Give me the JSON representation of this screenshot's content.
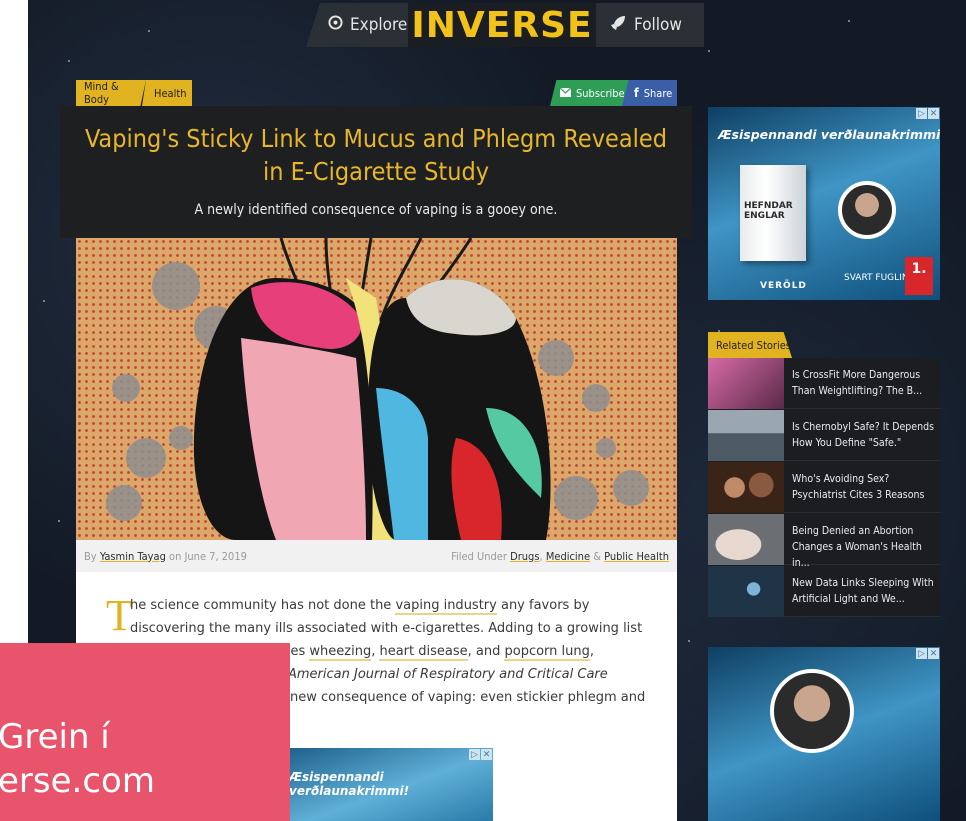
{
  "nav": {
    "explore_label": "Explore",
    "logo_text": "INVERSE",
    "follow_label": "Follow"
  },
  "article": {
    "categories": [
      "Mind & Body",
      "Health"
    ],
    "subscribe_label": "Subscribe",
    "share_label": "Share",
    "headline": "Vaping's Sticky Link to Mucus and Phlegm Revealed in E-Cigarette Study",
    "subheadline": "A newly identified consequence of vaping is a gooey one.",
    "byline": {
      "by": "By",
      "author": "Yasmin Tayag",
      "on": "on June 7, 2019",
      "filed_under": "Filed Under",
      "tags": [
        "Drugs",
        "Medicine",
        "Public Health"
      ],
      "sep1": ",",
      "sep2": "&"
    },
    "dropcap": "T",
    "body": {
      "l1_a": "he science community has not done the ",
      "l1_link": "vaping industry",
      "l1_b": " any favors by",
      "l2": "discovering the many ills associated with e-cigarettes. Adding to a growing list",
      "l3_a": "udes ",
      "l3_link1": "wheezing",
      "l3_sep1": ", ",
      "l3_link2": "heart disease",
      "l3_sep2": ", and ",
      "l3_link3": "popcorn lung",
      "l3_end": ",",
      "l4": "American Journal of Respiratory and Critical Care",
      "l5": "new consequence of vaping: even stickier phlegm and"
    }
  },
  "ads": {
    "tagline": "Æsispennandi verðlaunakrimmi!",
    "book_title": "HEFNDAR ENGLAR",
    "publisher_left": "VERÖLD",
    "publisher_mid": "SVART FUGLINN",
    "publisher_right": "1.",
    "ad_marker": "▷",
    "close_marker": "✕"
  },
  "related": {
    "label": "Related Stories",
    "items": [
      {
        "title": "Is CrossFit More Dangerous Than Weightlifting? The B...",
        "thumb_color": "#8e3a66"
      },
      {
        "title": "Is Chernobyl Safe? It Depends How You Define \"Safe.\"",
        "thumb_color": "#4c5a64"
      },
      {
        "title": "Who's Avoiding Sex? Psychiatrist Cites 3 Reasons",
        "thumb_color": "#5a3a2a"
      },
      {
        "title": "Being Denied an Abortion Changes a Woman's Health in...",
        "thumb_color": "#6b6e72"
      },
      {
        "title": "New Data Links Sleeping With Artificial Light and We...",
        "thumb_color": "#1f3446"
      }
    ]
  },
  "overlay": {
    "line1": "Grein í",
    "line2": "erse.com"
  },
  "colors": {
    "accent_gold": "#e2b321",
    "overlay_pink": "#e8546b",
    "subscribe_green": "#2e9e57",
    "share_blue": "#3a5fa8"
  }
}
